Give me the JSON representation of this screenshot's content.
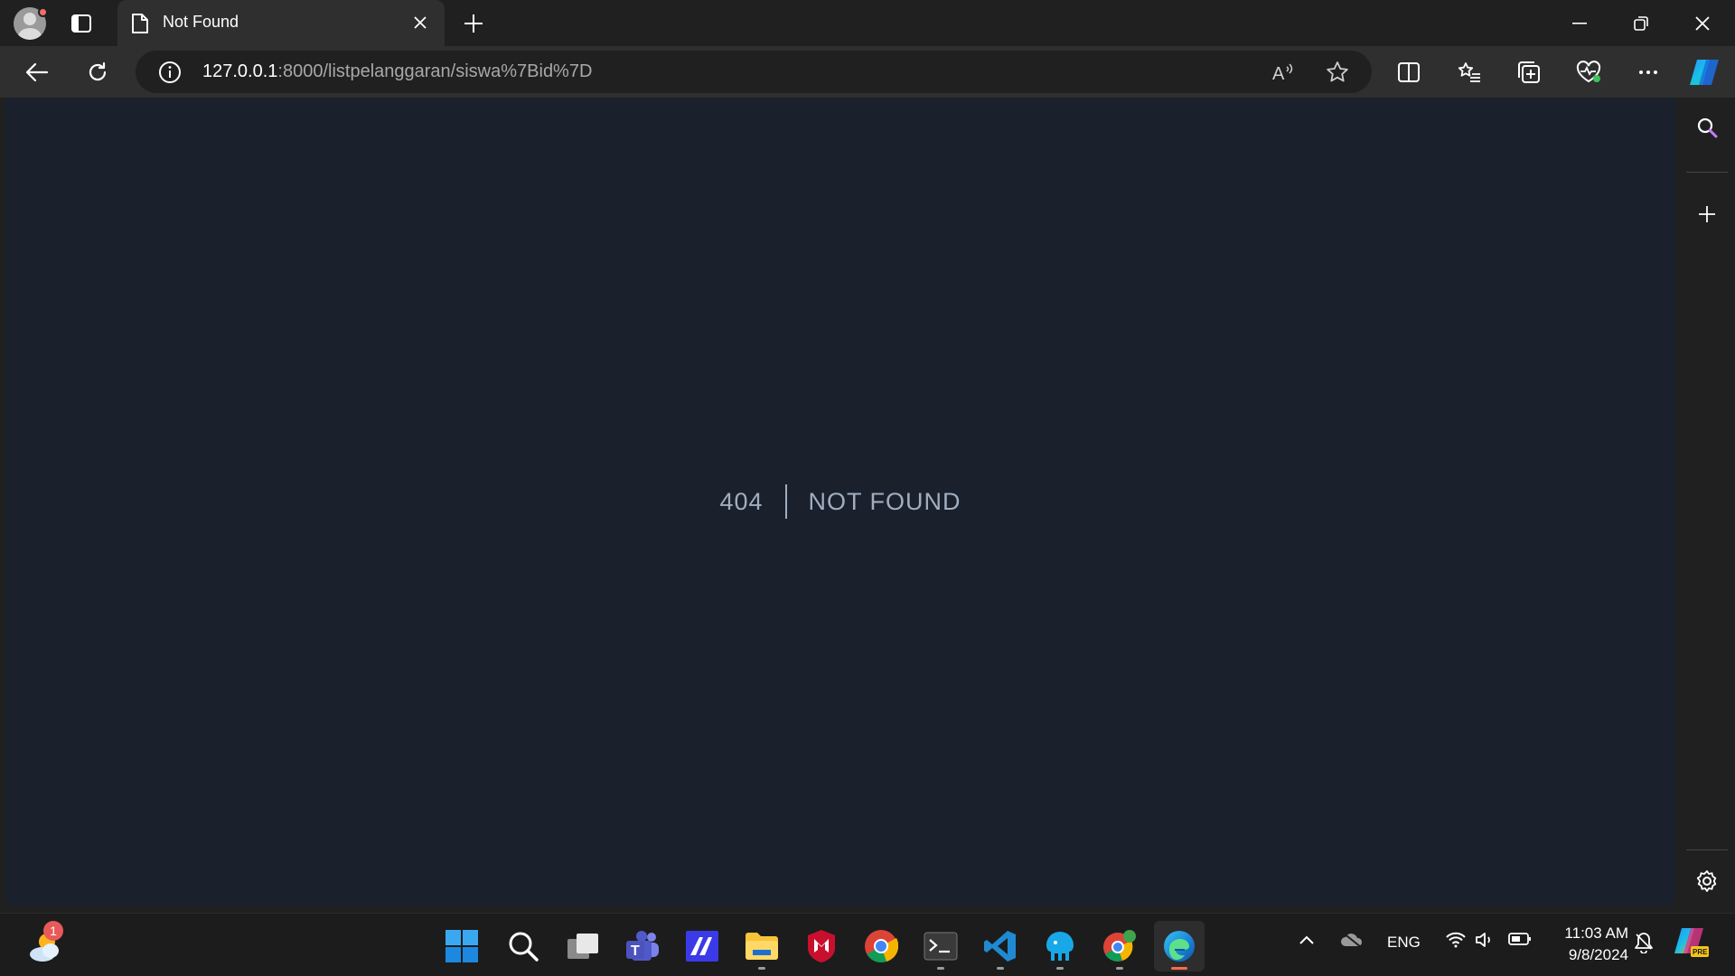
{
  "browser": {
    "tab": {
      "title": "Not Found"
    },
    "address_bar": {
      "url_host": "127.0.0.1",
      "url_path": ":8000/listpelanggaran/siswa%7Bid%7D"
    }
  },
  "page": {
    "background": "#1a202c",
    "text_color": "#a0aec0",
    "error_code": "404",
    "error_message": "Not Found"
  },
  "taskbar": {
    "weather_badge": "1",
    "apps": [
      "weather",
      "start",
      "search",
      "task-view",
      "teams",
      "sketch-app",
      "file-explorer",
      "mcafee",
      "chrome",
      "terminal",
      "vscode",
      "app-bird",
      "chrome-profile",
      "edge"
    ],
    "tray": {
      "language": "ENG",
      "time": "11:03 AM",
      "date": "9/8/2024"
    }
  }
}
